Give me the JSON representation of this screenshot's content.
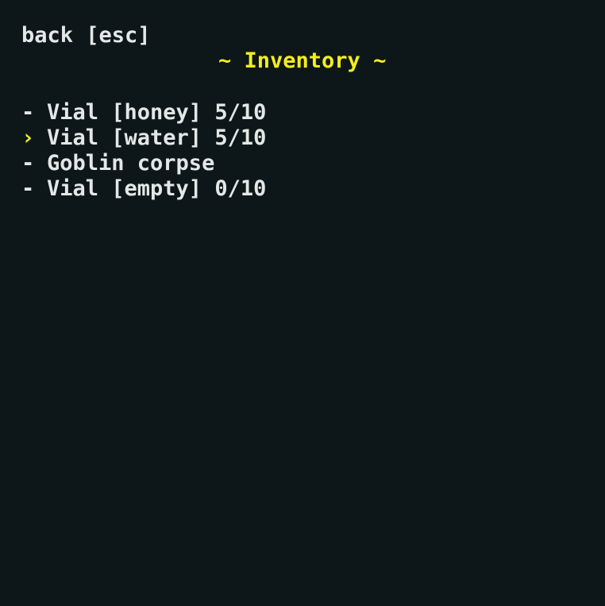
{
  "header": {
    "back_label": "back [esc]",
    "title": "~ Inventory ~"
  },
  "inventory": {
    "selected_index": 1,
    "items": [
      {
        "marker": "-",
        "label": "Vial [honey] 5/10"
      },
      {
        "marker": "›",
        "label": "Vial [water] 5/10"
      },
      {
        "marker": "-",
        "label": "Goblin corpse"
      },
      {
        "marker": "-",
        "label": "Vial [empty] 0/10"
      }
    ]
  },
  "colors": {
    "background": "#0d1719",
    "text": "#e3e7e6",
    "accent": "#f4ee1c"
  }
}
